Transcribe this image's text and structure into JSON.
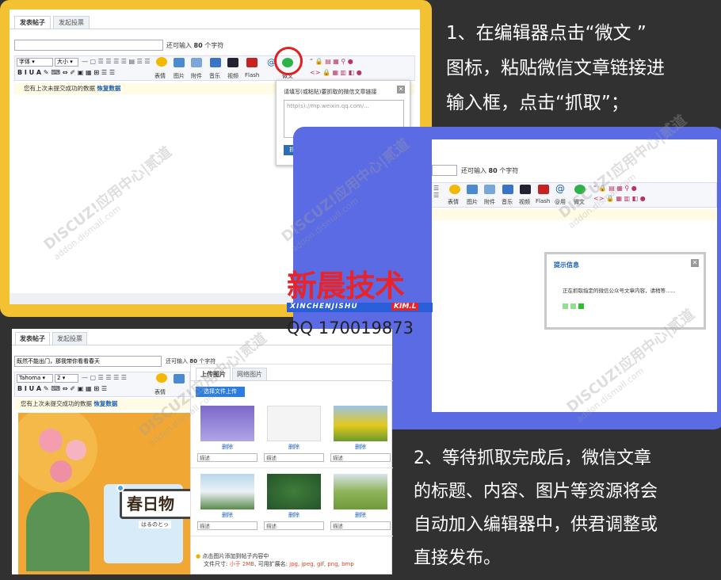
{
  "panel1": {
    "tab_post": "发表帖子",
    "tab_poll": "发起投票",
    "title_hint_prefix": "还可输入",
    "title_hint_count": "80",
    "title_hint_suffix": "个字符",
    "font_select": "字体",
    "size_select": "大小",
    "tools": [
      "表情",
      "图片",
      "附件",
      "音乐",
      "视频",
      "Flash",
      "@",
      "微文"
    ],
    "notice_text": "您有上次未提交成功的数据",
    "notice_link": "恢复数据",
    "popup_title": "请填写(或粘贴)要抓取的微信文章链接",
    "popup_placeholder": "http(s)://mp.weixin.qq.com/...",
    "popup_button": "抓取"
  },
  "panel2": {
    "title_hint_prefix": "还可输入",
    "title_hint_count": "80",
    "title_hint_suffix": "个字符",
    "tools": [
      "表情",
      "图片",
      "附件",
      "音乐",
      "视频",
      "Flash",
      "@用",
      "微文"
    ],
    "dialog_title": "提示信息",
    "dialog_message": "正在抓取指定的微信公众号文章内容，请稍等......"
  },
  "panel3": {
    "tab_post": "发表帖子",
    "tab_poll": "发起投票",
    "title_value": "既然不能出门，那我带你看看春天",
    "title_hint_prefix": "还可输入",
    "title_hint_count": "80",
    "title_hint_suffix": "个字符",
    "font_select": "Tahoma",
    "size_select": "2",
    "tool_emoji": "表情",
    "notice_text": "您有上次未提交成功的数据",
    "notice_link": "恢复数据",
    "banner_text": "春日物",
    "banner_sub": "はるのとっ",
    "upload_tab_local": "上传图片",
    "upload_tab_web": "网络图片",
    "upload_button": "选择文件上传",
    "delete_label": "删除",
    "desc_placeholder": "描述",
    "help_line1": "点击图片添加到帖子内容中",
    "help_size_prefix": "文件尺寸:",
    "help_size_value": "小于 2MB",
    "help_ext_prefix": ", 可用扩展名:",
    "help_ext_value": "jpg, jpeg, gif, png, bmp"
  },
  "steps": {
    "step1": [
      "1、在编辑器点击“微文 ”",
      "图标，粘贴微信文章链接进",
      "输入框，点击“抓取”；"
    ],
    "step2": [
      "2、等待抓取完成后，微信文章",
      "的标题、内容、图片等资源将会",
      "自动加入编辑器中，供君调整或",
      "直接发布。"
    ]
  },
  "brand": {
    "logo_text": "新晨技术",
    "logo_sub_left": "XINCHENJISHU",
    "logo_sub_right": "KIM.L",
    "qq": "QQ 170019873"
  },
  "watermark": {
    "line1": "DISCUZ!应用中心|贰道",
    "line2": "addon.dismall.com"
  },
  "colors": {
    "yellow": "#f2c232",
    "blue": "#5b6be3",
    "logo_red": "#e8232a",
    "logo_blue": "#2b5fd9",
    "link": "#1a5fb4"
  }
}
